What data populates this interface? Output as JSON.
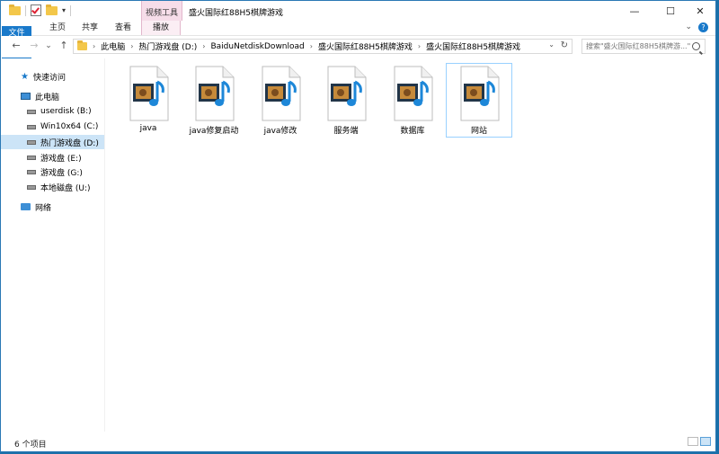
{
  "window": {
    "title": "盛火国际红88H5棋牌游戏",
    "context_tab_group": "视频工具",
    "controls": {
      "minimize": "—",
      "maximize": "☐",
      "close": "✕"
    }
  },
  "ribbon": {
    "tabs": [
      "文件",
      "主页",
      "共享",
      "查看",
      "播放"
    ],
    "help": "?"
  },
  "nav": {
    "back": "←",
    "forward": "→",
    "recent": "⌄",
    "up": "↑",
    "breadcrumb": [
      "此电脑",
      "热门游戏盘 (D:)",
      "BaiduNetdiskDownload",
      "盛火国际红88H5棋牌游戏",
      "盛火国际红88H5棋牌游戏"
    ],
    "search_placeholder": "搜索\"盛火国际红88H5棋牌游...\""
  },
  "sidebar": {
    "items": [
      {
        "label": "快速访问",
        "icon": "quick-access-icon",
        "indent": 1
      },
      {
        "label": "此电脑",
        "icon": "this-pc-icon",
        "indent": 1
      },
      {
        "label": "userdisk (B:)",
        "icon": "drive-icon",
        "indent": 2
      },
      {
        "label": "Win10x64 (C:)",
        "icon": "drive-icon",
        "indent": 2
      },
      {
        "label": "热门游戏盘 (D:)",
        "icon": "drive-icon",
        "indent": 2,
        "selected": true
      },
      {
        "label": "游戏盘 (E:)",
        "icon": "drive-icon",
        "indent": 2
      },
      {
        "label": "游戏盘 (G:)",
        "icon": "drive-icon",
        "indent": 2
      },
      {
        "label": "本地磁盘 (U:)",
        "icon": "drive-icon",
        "indent": 2
      },
      {
        "label": "网络",
        "icon": "network-icon",
        "indent": 1
      }
    ]
  },
  "files": [
    {
      "name": "java",
      "icon": "video-file-icon"
    },
    {
      "name": "java修复启动",
      "icon": "video-file-icon"
    },
    {
      "name": "java修改",
      "icon": "video-file-icon"
    },
    {
      "name": "服务端",
      "icon": "video-file-icon"
    },
    {
      "name": "数据库",
      "icon": "video-file-icon"
    },
    {
      "name": "网站",
      "icon": "video-file-icon",
      "selected": true
    }
  ],
  "status": {
    "count": "6 个项目"
  },
  "colors": {
    "accent": "#1979ca",
    "selection": "#cce4f7",
    "context_tab": "#f6dde9",
    "desktop": "#1a6fa8"
  }
}
